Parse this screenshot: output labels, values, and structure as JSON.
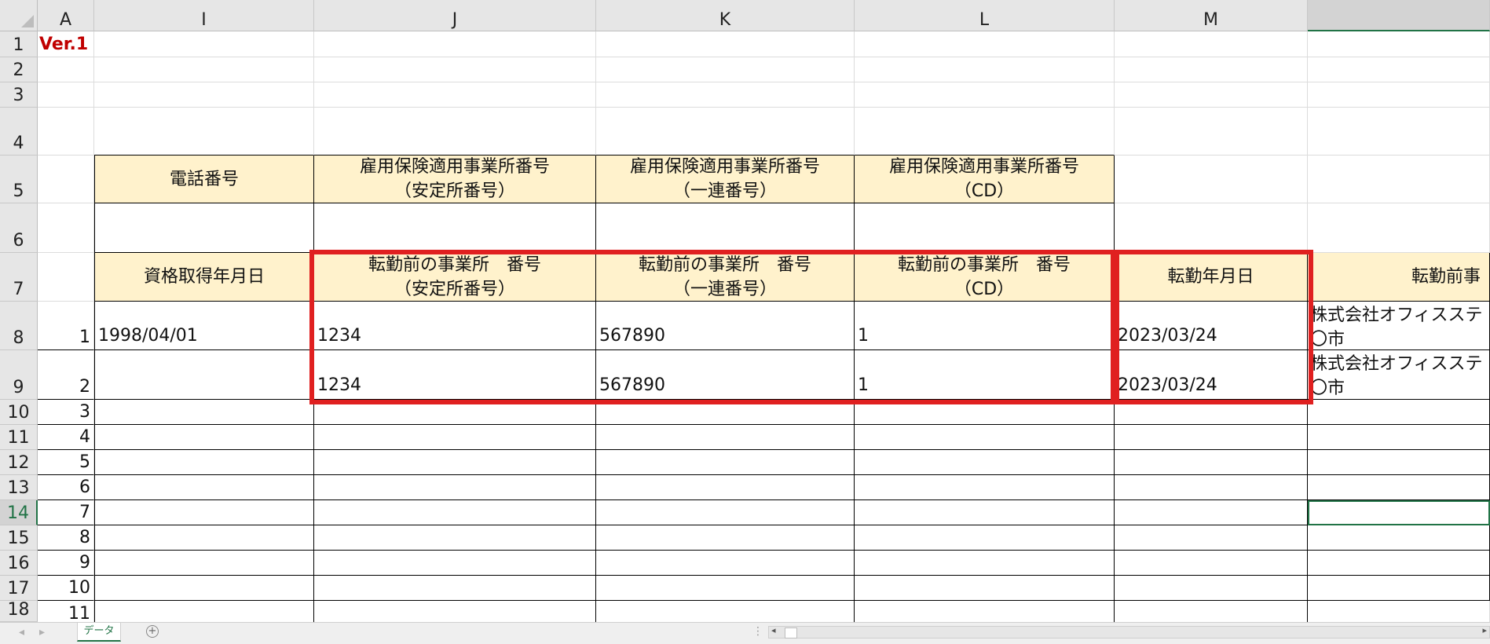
{
  "columns": [
    "A",
    "I",
    "J",
    "K",
    "L",
    "M",
    ""
  ],
  "rows": [
    "1",
    "2",
    "3",
    "4",
    "5",
    "6",
    "7",
    "8",
    "9",
    "10",
    "11",
    "12",
    "13",
    "14",
    "15",
    "16",
    "17",
    "18"
  ],
  "version_label": "Ver.1",
  "header_row5": {
    "phone": "電話番号",
    "office_no_a": [
      "雇用保険適用事業所番号",
      "（安定所番号）"
    ],
    "office_no_b": [
      "雇用保険適用事業所番号",
      "（一連番号）"
    ],
    "office_no_c": [
      "雇用保険適用事業所番号",
      "（CD）"
    ]
  },
  "header_row7": {
    "acq_date": "資格取得年月日",
    "prev_a": [
      "転勤前の事業所　番号",
      "（安定所番号）"
    ],
    "prev_b": [
      "転勤前の事業所　番号",
      "（一連番号）"
    ],
    "prev_c": [
      "転勤前の事業所　番号",
      "（CD）"
    ],
    "transfer_date": "転勤年月日",
    "prev_name": "転勤前事"
  },
  "data_rows": [
    {
      "no": "1",
      "acq_date": "1998/04/01",
      "prev_a": "1234",
      "prev_b": "567890",
      "prev_c": "1",
      "transfer_date": "2023/03/24",
      "prev_name": [
        "株式会社オフィスステ",
        "〇市"
      ]
    },
    {
      "no": "2",
      "acq_date": "",
      "prev_a": "1234",
      "prev_b": "567890",
      "prev_c": "1",
      "transfer_date": "2023/03/24",
      "prev_name": [
        "株式会社オフィスステ",
        "〇市"
      ]
    }
  ],
  "row_numbers": [
    "3",
    "4",
    "5",
    "6",
    "7",
    "8",
    "9",
    "10",
    "11"
  ],
  "sheet_tab": "データ",
  "colors": {
    "header_fill": "#fff2cc",
    "highlight_box": "#e02020",
    "excel_green": "#217346",
    "version_red": "#c00000"
  }
}
